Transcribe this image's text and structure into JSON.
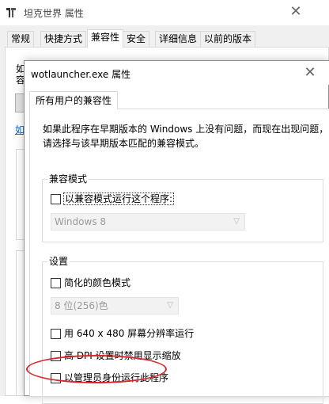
{
  "back_window": {
    "title": "坦克世界 属性",
    "close_glyph": "✕",
    "tabs": [
      {
        "label": "常规"
      },
      {
        "label": "快捷方式"
      },
      {
        "label": "兼容性"
      },
      {
        "label": "安全"
      },
      {
        "label": "详细信息"
      },
      {
        "label": "以前的版本"
      }
    ],
    "active_tab": "兼容性",
    "peek": {
      "text_line1": "如",
      "text_line2": "容",
      "link_text": "如"
    }
  },
  "dialog": {
    "title": "wotlauncher.exe 属性",
    "close_glyph": "✕",
    "tab_label": "所有用户的兼容性",
    "intro_line1": "如果此程序在早期版本的 Windows 上没有问题，而现在出现问题，",
    "intro_line2": "请选择与该早期版本匹配的兼容模式。",
    "compat_group": {
      "label": "兼容模式",
      "checkbox_label": "以兼容模式运行这个程序:",
      "checked": false,
      "select_value": "Windows 8",
      "select_enabled": false
    },
    "settings_group": {
      "label": "设置",
      "reduced_color": {
        "label": "简化的颜色模式",
        "checked": false
      },
      "color_select": {
        "value": "8 位(256)色",
        "enabled": false
      },
      "resolution_640": {
        "label": "用 640 x 480 屏幕分辨率运行",
        "checked": false
      },
      "high_dpi": {
        "label": "高 DPI 设置时禁用显示缩放",
        "checked": false
      },
      "run_as_admin": {
        "label": "以管理员身份运行此程序",
        "checked": false,
        "highlighted": true
      }
    }
  },
  "colors": {
    "highlight_ring": "#d8272f",
    "link": "#0066cc",
    "disabled_text": "#9a9a9a"
  }
}
